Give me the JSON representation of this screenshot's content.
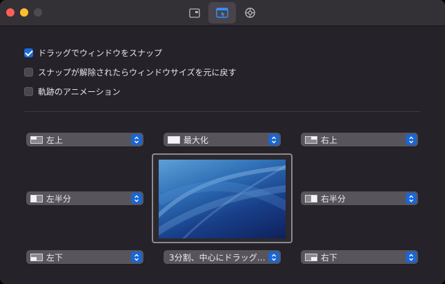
{
  "toolbar": {
    "tabs": [
      {
        "icon": "window-preview-icon",
        "active": false
      },
      {
        "icon": "snap-window-icon",
        "active": true
      },
      {
        "icon": "gear-icon",
        "active": false
      }
    ]
  },
  "options": {
    "drag_snap": {
      "label": "ドラッグでウィンドウをスナップ",
      "checked": true
    },
    "restore_size": {
      "label": "スナップが解除されたらウィンドウサイズを元に戻す",
      "checked": false
    },
    "trail_animation": {
      "label": "軌跡のアニメーション",
      "checked": false
    }
  },
  "snap": {
    "top_left": "左上",
    "top": "最大化",
    "top_right": "右上",
    "left": "左半分",
    "right": "右半分",
    "bottom_left": "左下",
    "bottom": "3分割、中心にドラッグ…",
    "bottom_right": "右下"
  },
  "colors": {
    "accent": "#1b66d3",
    "window_bg": "#252229",
    "popup_bg": "#57545b"
  }
}
